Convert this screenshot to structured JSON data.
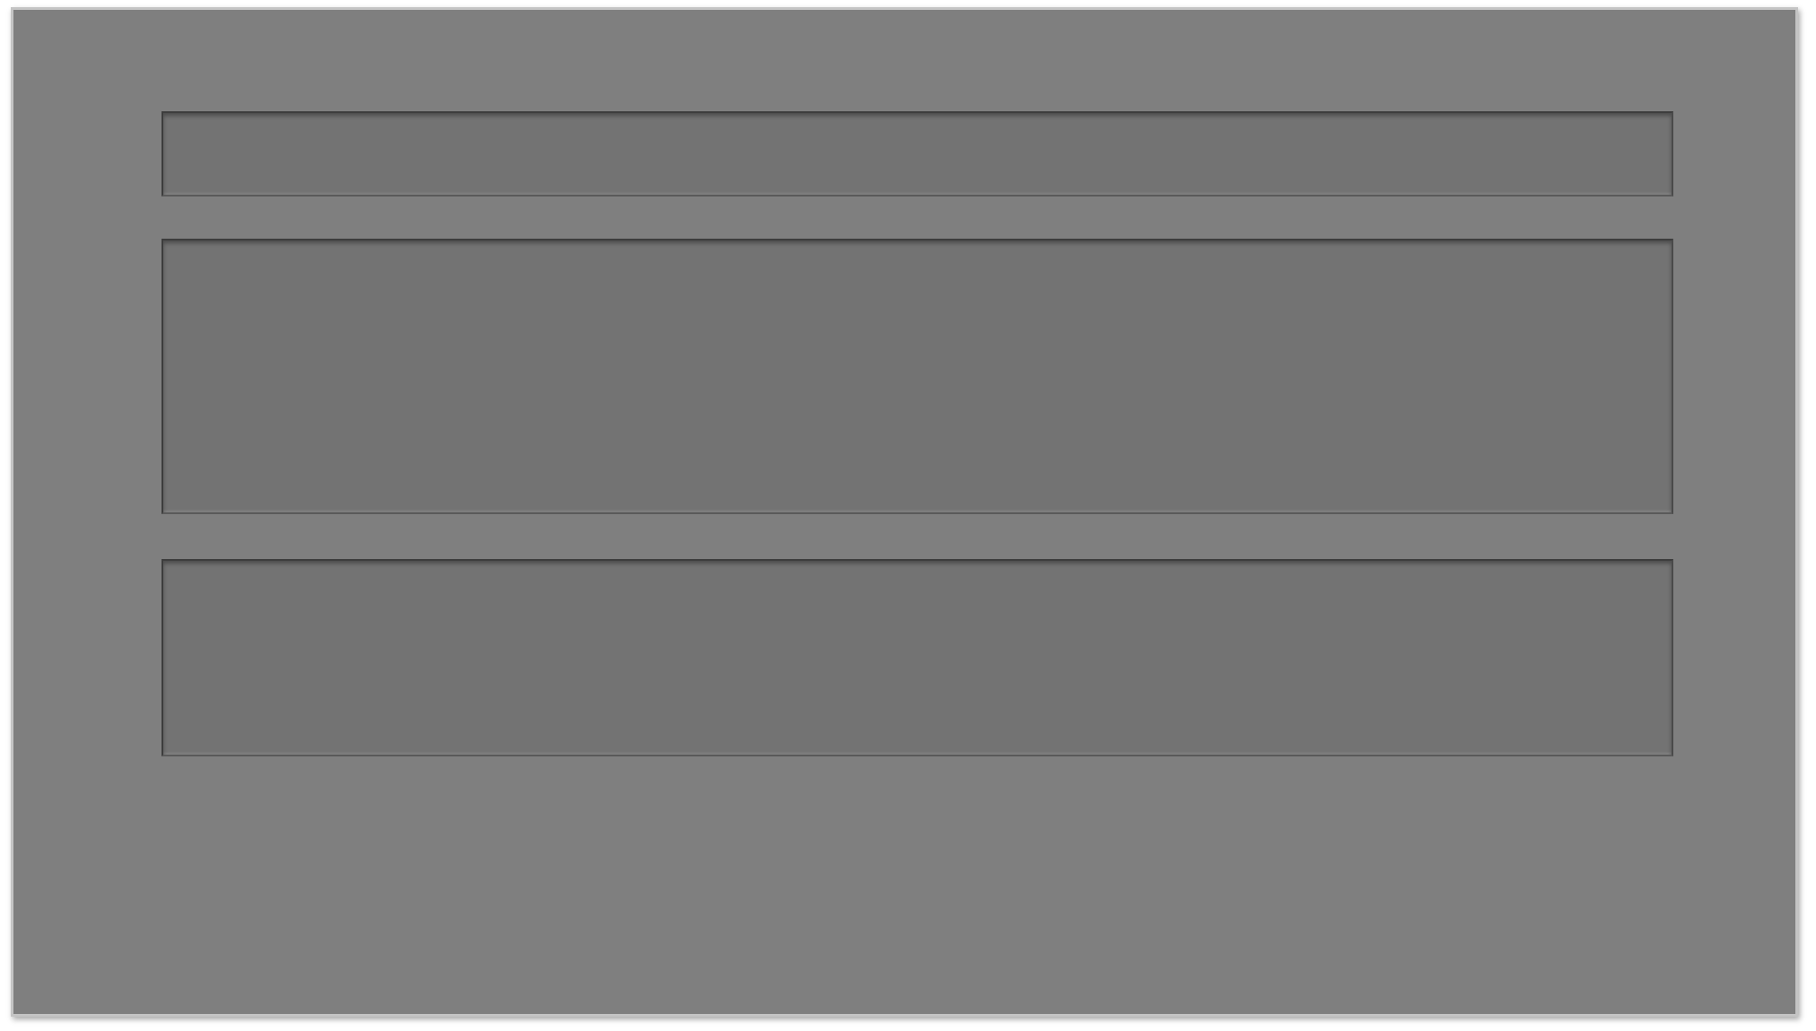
{
  "screen": {
    "background_color": "#7f7f7f",
    "panel_color": "#737373",
    "panels": [
      {
        "id": "panel-1",
        "text": ""
      },
      {
        "id": "panel-2",
        "text": ""
      },
      {
        "id": "panel-3",
        "text": ""
      }
    ]
  }
}
